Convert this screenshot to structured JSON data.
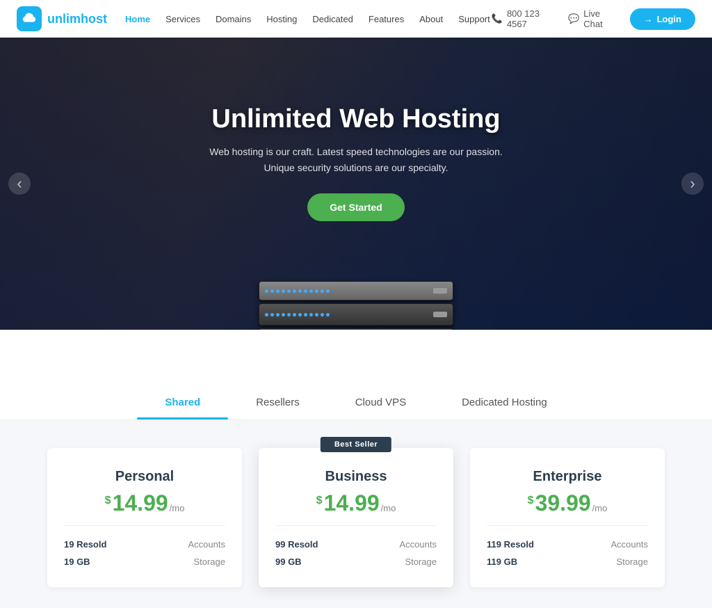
{
  "navbar": {
    "logo_text_main": "unlim",
    "logo_text_brand": "host",
    "nav_items": [
      {
        "label": "Home",
        "active": true
      },
      {
        "label": "Services",
        "active": false
      },
      {
        "label": "Domains",
        "active": false
      },
      {
        "label": "Hosting",
        "active": false
      },
      {
        "label": "Dedicated",
        "active": false
      },
      {
        "label": "Features",
        "active": false
      },
      {
        "label": "About",
        "active": false
      },
      {
        "label": "Support",
        "active": false
      }
    ],
    "phone": "800 123 4567",
    "live_chat": "Live Chat",
    "login_label": "Login"
  },
  "hero": {
    "title": "Unlimited Web Hosting",
    "subtitle_line1": "Web hosting is our craft. Latest speed technologies are our passion.",
    "subtitle_line2": "Unique security solutions are our specialty.",
    "cta_label": "Get Started",
    "arrow_left": "‹",
    "arrow_right": "›"
  },
  "tabs": [
    {
      "label": "Shared",
      "active": true
    },
    {
      "label": "Resellers",
      "active": false
    },
    {
      "label": "Cloud VPS",
      "active": false
    },
    {
      "label": "Dedicated Hosting",
      "active": false
    }
  ],
  "pricing": {
    "badge": "Best Seller",
    "cards": [
      {
        "title": "Personal",
        "price_dollar": "$",
        "price_amount": "14.99",
        "price_mo": "/mo",
        "featured": false,
        "features": [
          {
            "value": "19 Resold",
            "label": "Accounts"
          },
          {
            "value": "19 GB",
            "label": "Storage"
          }
        ]
      },
      {
        "title": "Business",
        "price_dollar": "$",
        "price_amount": "14.99",
        "price_mo": "/mo",
        "featured": true,
        "features": [
          {
            "value": "99 Resold",
            "label": "Accounts"
          },
          {
            "value": "99 GB",
            "label": "Storage"
          }
        ]
      },
      {
        "title": "Enterprise",
        "price_dollar": "$",
        "price_amount": "39.99",
        "price_mo": "/mo",
        "featured": false,
        "features": [
          {
            "value": "119 Resold",
            "label": "Accounts"
          },
          {
            "value": "119 GB",
            "label": "Storage"
          }
        ]
      }
    ]
  }
}
